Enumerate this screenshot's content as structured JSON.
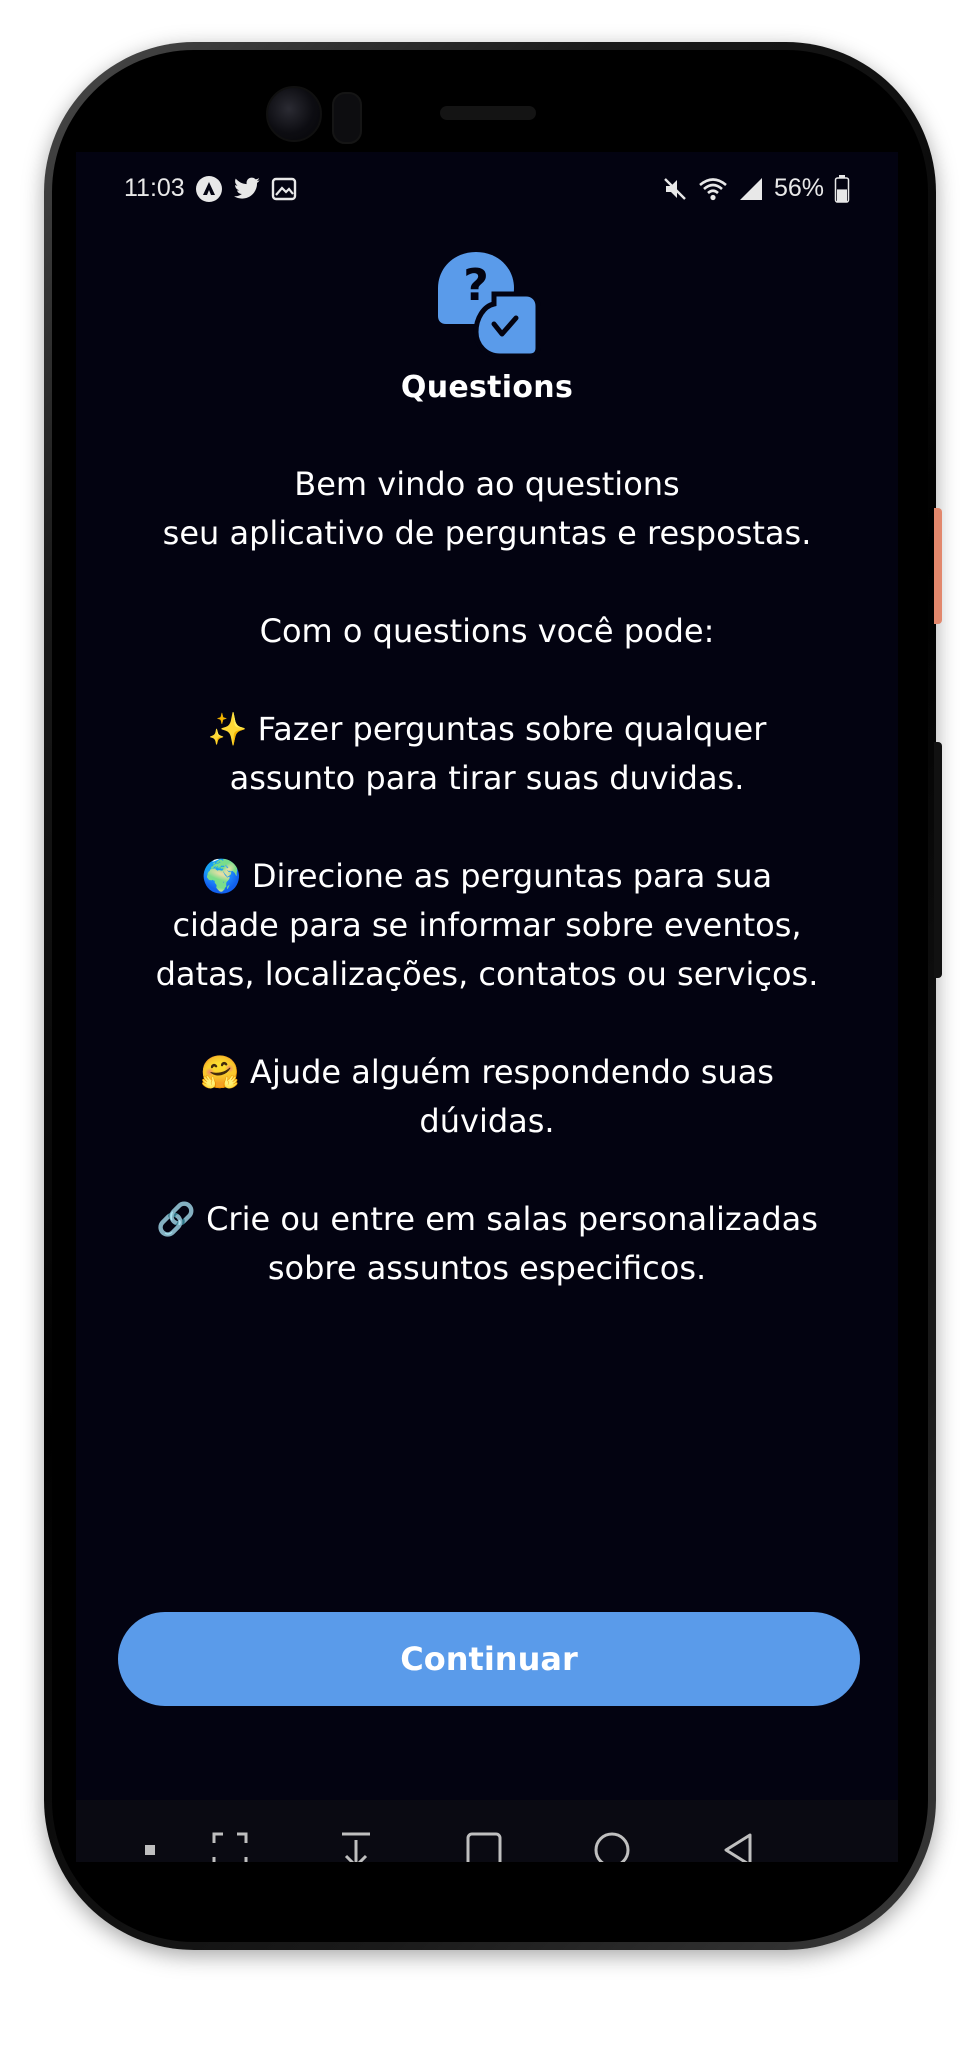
{
  "status_bar": {
    "time": "11:03",
    "left_icons": [
      "app-a-icon",
      "twitter-icon",
      "image-icon"
    ],
    "right_icons": [
      "mute-icon",
      "wifi-icon",
      "signal-icon"
    ],
    "battery_percent": "56%",
    "battery_level": 0.56
  },
  "app": {
    "logo": "question-chat-bubbles-icon",
    "title": "Questions"
  },
  "intro": {
    "line1": "Bem vindo ao questions",
    "line2": "seu aplicativo de perguntas e respostas.",
    "line3": "Com o questions você pode:"
  },
  "features": [
    {
      "icon": "sparkles-icon",
      "emoji": "✨",
      "text_line1": "Fazer perguntas sobre qualquer",
      "text_line2": "assunto para tirar suas duvidas."
    },
    {
      "icon": "globe-icon",
      "emoji": "🌍",
      "text_line1": "Direcione as perguntas para sua",
      "text_line2": "cidade para se informar sobre eventos,",
      "text_line3": "datas, localizações, contatos ou serviços."
    },
    {
      "icon": "hugging-face-icon",
      "emoji": "🤗",
      "text_line1": "Ajude alguém respondendo suas",
      "text_line2": "dúvidas."
    },
    {
      "icon": "link-icon",
      "emoji": "🔗",
      "text_line1": "Crie ou entre em salas personalizadas",
      "text_line2": "sobre assuntos especificos."
    }
  ],
  "cta": {
    "label": "Continuar"
  },
  "navbar": {
    "items": [
      "keyboard-dot-icon",
      "screenshot-icon",
      "download-icon",
      "recents-icon",
      "home-icon",
      "back-icon"
    ]
  },
  "colors": {
    "background": "#030311",
    "accent": "#5a9bea",
    "text": "#ffffff",
    "frame_side_button": "#e2876c"
  }
}
